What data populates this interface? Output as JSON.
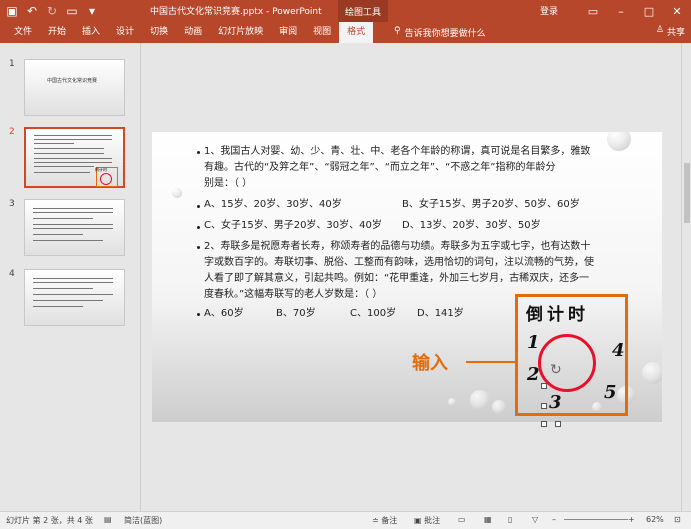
{
  "window": {
    "title": "中国古代文化常识竞赛.pptx - PowerPoint",
    "context_tab": "绘图工具",
    "login": "登录"
  },
  "ribbon": {
    "tabs": [
      "文件",
      "开始",
      "插入",
      "设计",
      "切换",
      "动画",
      "幻灯片放映",
      "审阅",
      "视图",
      "格式"
    ],
    "active_tab": "格式",
    "tell_me": "告诉我你想要做什么",
    "share": "共享"
  },
  "thumbnails": [
    {
      "num": "1",
      "title": "中国古代文化常识竞赛"
    },
    {
      "num": "2",
      "badge": "倒计时"
    },
    {
      "num": "3"
    },
    {
      "num": "4"
    }
  ],
  "slide": {
    "q1_lines": [
      "1、我国古人对婴、幼、少、青、壮、中、老各个年龄的称谓，真可说是名目繁多，雅致",
      "有趣。古代的“及笄之年”、“弱冠之年”、“而立之年”、“不惑之年”指称的年龄分",
      "别是：（   ）"
    ],
    "q1_a": "A、15岁、20岁、30岁、40岁",
    "q1_b": "B、女子15岁、男子20岁、50岁、60岁",
    "q1_c": "C、女子15岁、男子20岁、30岁、40岁",
    "q1_d": "D、13岁、20岁、30岁、50岁",
    "q2_lines": [
      "2、寿联多是祝愿寿者长寿，称颂寿者的品德与功绩。寿联多为五字或七字，也有达数十",
      "字或数百字的。寿联切事、脱俗、工整而有韵味，选用恰切的词句，注以流畅的气势，使",
      "人看了即了解其意义，引起共鸣。例如：“花甲重逢，外加三七岁月，古稀双庆，还多一",
      "度春秋。”这幅寿联写的老人岁数是：（   ）"
    ],
    "q2_a": "A、60岁",
    "q2_b": "B、70岁",
    "q2_c": "C、100岁",
    "q2_d": "D、141岁",
    "countdown_title": "倒计时",
    "numbers": [
      "1",
      "2",
      "3",
      "4",
      "5"
    ],
    "input_label": "输入"
  },
  "status": {
    "slide_info": "幻灯片 第 2 张，共 4 张",
    "theme": "简洁(蓝图)",
    "notes": "备注",
    "comments": "批注",
    "zoom": "62%"
  }
}
